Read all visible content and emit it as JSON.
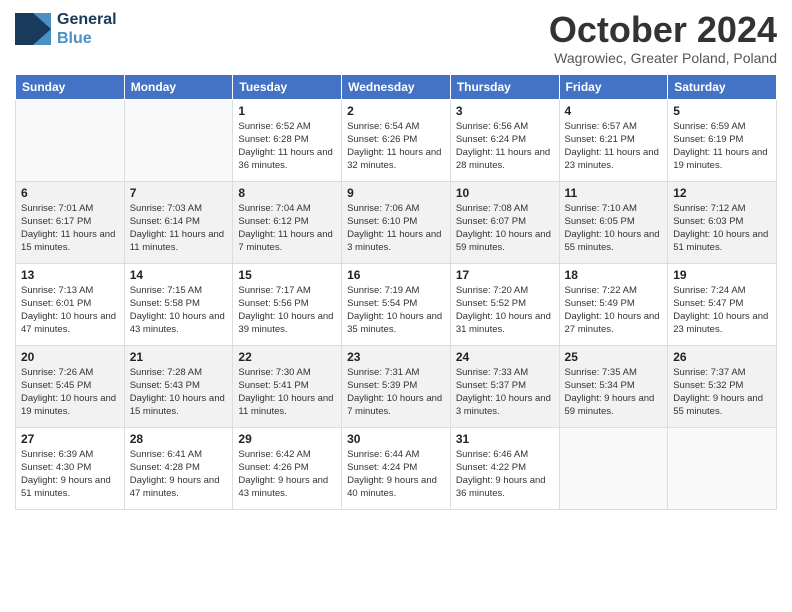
{
  "header": {
    "logo_line1": "General",
    "logo_line2": "Blue",
    "month_title": "October 2024",
    "subtitle": "Wagrowiec, Greater Poland, Poland"
  },
  "days_of_week": [
    "Sunday",
    "Monday",
    "Tuesday",
    "Wednesday",
    "Thursday",
    "Friday",
    "Saturday"
  ],
  "weeks": [
    [
      {
        "day": "",
        "info": ""
      },
      {
        "day": "",
        "info": ""
      },
      {
        "day": "1",
        "info": "Sunrise: 6:52 AM\nSunset: 6:28 PM\nDaylight: 11 hours and 36 minutes."
      },
      {
        "day": "2",
        "info": "Sunrise: 6:54 AM\nSunset: 6:26 PM\nDaylight: 11 hours and 32 minutes."
      },
      {
        "day": "3",
        "info": "Sunrise: 6:56 AM\nSunset: 6:24 PM\nDaylight: 11 hours and 28 minutes."
      },
      {
        "day": "4",
        "info": "Sunrise: 6:57 AM\nSunset: 6:21 PM\nDaylight: 11 hours and 23 minutes."
      },
      {
        "day": "5",
        "info": "Sunrise: 6:59 AM\nSunset: 6:19 PM\nDaylight: 11 hours and 19 minutes."
      }
    ],
    [
      {
        "day": "6",
        "info": "Sunrise: 7:01 AM\nSunset: 6:17 PM\nDaylight: 11 hours and 15 minutes."
      },
      {
        "day": "7",
        "info": "Sunrise: 7:03 AM\nSunset: 6:14 PM\nDaylight: 11 hours and 11 minutes."
      },
      {
        "day": "8",
        "info": "Sunrise: 7:04 AM\nSunset: 6:12 PM\nDaylight: 11 hours and 7 minutes."
      },
      {
        "day": "9",
        "info": "Sunrise: 7:06 AM\nSunset: 6:10 PM\nDaylight: 11 hours and 3 minutes."
      },
      {
        "day": "10",
        "info": "Sunrise: 7:08 AM\nSunset: 6:07 PM\nDaylight: 10 hours and 59 minutes."
      },
      {
        "day": "11",
        "info": "Sunrise: 7:10 AM\nSunset: 6:05 PM\nDaylight: 10 hours and 55 minutes."
      },
      {
        "day": "12",
        "info": "Sunrise: 7:12 AM\nSunset: 6:03 PM\nDaylight: 10 hours and 51 minutes."
      }
    ],
    [
      {
        "day": "13",
        "info": "Sunrise: 7:13 AM\nSunset: 6:01 PM\nDaylight: 10 hours and 47 minutes."
      },
      {
        "day": "14",
        "info": "Sunrise: 7:15 AM\nSunset: 5:58 PM\nDaylight: 10 hours and 43 minutes."
      },
      {
        "day": "15",
        "info": "Sunrise: 7:17 AM\nSunset: 5:56 PM\nDaylight: 10 hours and 39 minutes."
      },
      {
        "day": "16",
        "info": "Sunrise: 7:19 AM\nSunset: 5:54 PM\nDaylight: 10 hours and 35 minutes."
      },
      {
        "day": "17",
        "info": "Sunrise: 7:20 AM\nSunset: 5:52 PM\nDaylight: 10 hours and 31 minutes."
      },
      {
        "day": "18",
        "info": "Sunrise: 7:22 AM\nSunset: 5:49 PM\nDaylight: 10 hours and 27 minutes."
      },
      {
        "day": "19",
        "info": "Sunrise: 7:24 AM\nSunset: 5:47 PM\nDaylight: 10 hours and 23 minutes."
      }
    ],
    [
      {
        "day": "20",
        "info": "Sunrise: 7:26 AM\nSunset: 5:45 PM\nDaylight: 10 hours and 19 minutes."
      },
      {
        "day": "21",
        "info": "Sunrise: 7:28 AM\nSunset: 5:43 PM\nDaylight: 10 hours and 15 minutes."
      },
      {
        "day": "22",
        "info": "Sunrise: 7:30 AM\nSunset: 5:41 PM\nDaylight: 10 hours and 11 minutes."
      },
      {
        "day": "23",
        "info": "Sunrise: 7:31 AM\nSunset: 5:39 PM\nDaylight: 10 hours and 7 minutes."
      },
      {
        "day": "24",
        "info": "Sunrise: 7:33 AM\nSunset: 5:37 PM\nDaylight: 10 hours and 3 minutes."
      },
      {
        "day": "25",
        "info": "Sunrise: 7:35 AM\nSunset: 5:34 PM\nDaylight: 9 hours and 59 minutes."
      },
      {
        "day": "26",
        "info": "Sunrise: 7:37 AM\nSunset: 5:32 PM\nDaylight: 9 hours and 55 minutes."
      }
    ],
    [
      {
        "day": "27",
        "info": "Sunrise: 6:39 AM\nSunset: 4:30 PM\nDaylight: 9 hours and 51 minutes."
      },
      {
        "day": "28",
        "info": "Sunrise: 6:41 AM\nSunset: 4:28 PM\nDaylight: 9 hours and 47 minutes."
      },
      {
        "day": "29",
        "info": "Sunrise: 6:42 AM\nSunset: 4:26 PM\nDaylight: 9 hours and 43 minutes."
      },
      {
        "day": "30",
        "info": "Sunrise: 6:44 AM\nSunset: 4:24 PM\nDaylight: 9 hours and 40 minutes."
      },
      {
        "day": "31",
        "info": "Sunrise: 6:46 AM\nSunset: 4:22 PM\nDaylight: 9 hours and 36 minutes."
      },
      {
        "day": "",
        "info": ""
      },
      {
        "day": "",
        "info": ""
      }
    ]
  ]
}
